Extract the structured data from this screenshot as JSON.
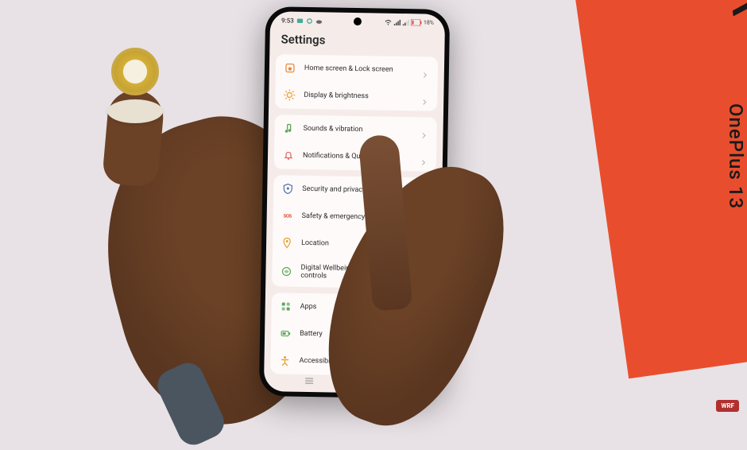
{
  "status": {
    "time": "9:53",
    "battery_pct": "18%"
  },
  "header": {
    "title": "Settings"
  },
  "groups": [
    {
      "items": [
        {
          "id": "home-lock",
          "label": "Home screen & Lock screen",
          "icon": "home-lock-icon",
          "color": "#e88a3c"
        },
        {
          "id": "display",
          "label": "Display & brightness",
          "icon": "sun-icon",
          "color": "#f0a030"
        }
      ]
    },
    {
      "items": [
        {
          "id": "sounds",
          "label": "Sounds & vibration",
          "icon": "music-note-icon",
          "color": "#5aa85a"
        },
        {
          "id": "notifications",
          "label": "Notifications & Quick Settings",
          "icon": "bell-icon",
          "color": "#e8605a"
        }
      ]
    },
    {
      "items": [
        {
          "id": "security",
          "label": "Security and privacy",
          "icon": "shield-icon",
          "color": "#4a6fb0"
        },
        {
          "id": "safety",
          "label": "Safety & emergency",
          "icon": "sos-icon",
          "color": "#e84e2e"
        },
        {
          "id": "location",
          "label": "Location",
          "icon": "location-pin-icon",
          "color": "#e8a030"
        },
        {
          "id": "wellbeing",
          "label": "Digital Wellbeing & parental controls",
          "icon": "wellbeing-icon",
          "color": "#5aa85a"
        }
      ]
    },
    {
      "items": [
        {
          "id": "apps",
          "label": "Apps",
          "icon": "apps-grid-icon",
          "color": "#5aa85a"
        },
        {
          "id": "battery",
          "label": "Battery",
          "icon": "battery-icon",
          "color": "#5aa85a"
        },
        {
          "id": "accessibility",
          "label": "Accessibility & convenience",
          "icon": "accessibility-icon",
          "color": "#e8a030"
        }
      ]
    }
  ],
  "nav": {
    "recent": "recent-apps",
    "home": "home",
    "back": "back"
  },
  "env": {
    "box_brand": "OnePlus 13",
    "box_number": "13"
  }
}
